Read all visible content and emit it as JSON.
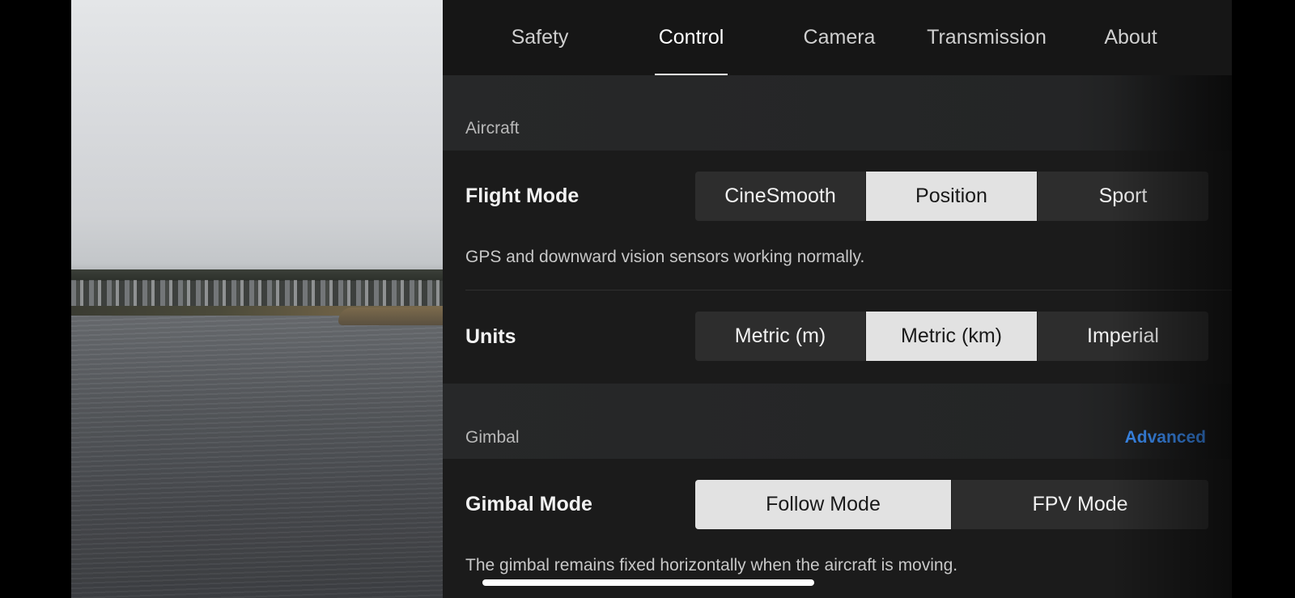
{
  "tabs": [
    {
      "label": "Safety",
      "active": false
    },
    {
      "label": "Control",
      "active": true
    },
    {
      "label": "Camera",
      "active": false
    },
    {
      "label": "Transmission",
      "active": false
    },
    {
      "label": "About",
      "active": false
    }
  ],
  "aircraft": {
    "section_title": "Aircraft",
    "flight_mode": {
      "label": "Flight Mode",
      "options": [
        "CineSmooth",
        "Position",
        "Sport"
      ],
      "selected": "Position",
      "description": "GPS and downward vision sensors working normally."
    },
    "units": {
      "label": "Units",
      "options": [
        "Metric (m)",
        "Metric (km)",
        "Imperial"
      ],
      "selected": "Metric (km)"
    }
  },
  "gimbal": {
    "section_title": "Gimbal",
    "advanced_link": "Advanced",
    "gimbal_mode": {
      "label": "Gimbal Mode",
      "options": [
        "Follow Mode",
        "FPV Mode"
      ],
      "selected": "Follow Mode",
      "description": "The gimbal remains fixed horizontally when the aircraft is moving."
    }
  },
  "colors": {
    "accent_link": "#3b8bf0",
    "selected_option_bg": "#e2e2e2",
    "panel_bg": "#1b1b1b"
  }
}
